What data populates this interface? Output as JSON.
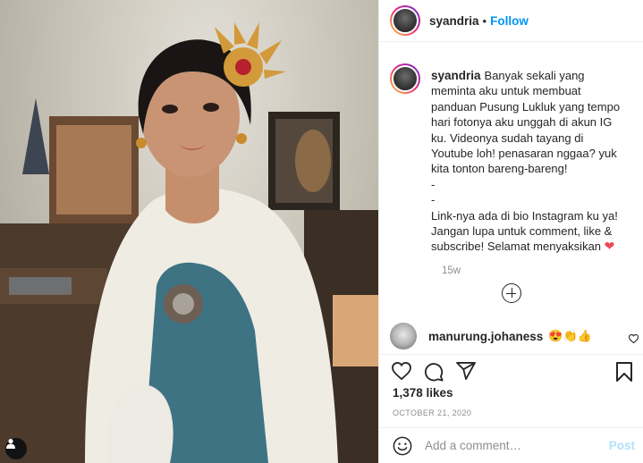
{
  "post": {
    "image": {
      "description_icon": "photo"
    },
    "owner": {
      "username": "syandria"
    },
    "header": {
      "dot": "•",
      "follow_label": "Follow"
    },
    "caption": {
      "lines": [
        "Banyak sekali yang",
        "meminta aku untuk membuat",
        "panduan Pusung Lukluk yang tempo",
        "hari fotonya aku unggah di akun IG",
        "ku. Videonya sudah tayang di",
        "Youtube loh! penasaran nggaa? yuk",
        "kita tonton bareng-bareng!",
        "-",
        "-",
        "Link-nya ada di bio Instagram ku ya!",
        "Jangan lupa untuk comment, like &",
        "subscribe! Selamat menyaksikan"
      ],
      "end_emoji": "❤",
      "time_ago": "15w"
    },
    "comments": [
      {
        "username": "manurung.johaness",
        "text": "😍👏👍"
      }
    ],
    "likes_label": "1,378 likes",
    "date": "OCTOBER 21, 2020",
    "add_comment": {
      "placeholder": "Add a comment…",
      "post_label": "Post"
    },
    "colors": {
      "accent": "#0095f6",
      "post_disabled": "#b2dffc",
      "heart": "#ed4956"
    }
  }
}
